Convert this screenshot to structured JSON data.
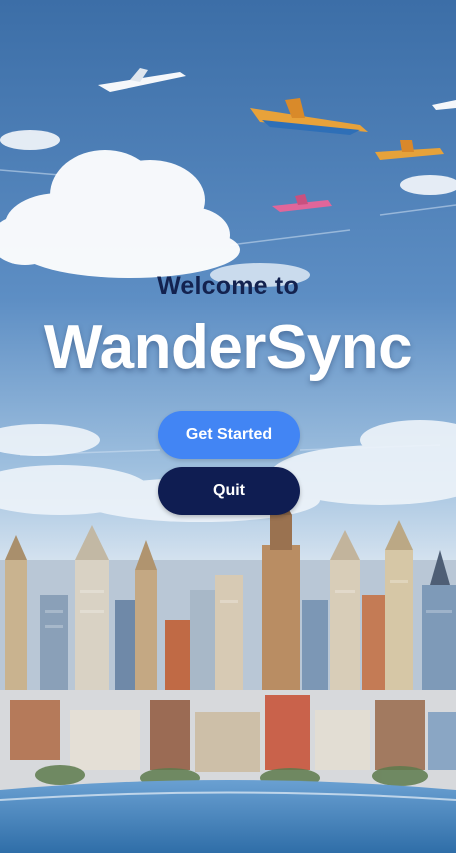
{
  "welcome": {
    "line1": "Welcome to",
    "app_name": "WanderSync"
  },
  "buttons": {
    "get_started_label": "Get Started",
    "quit_label": "Quit"
  },
  "colors": {
    "primary_button": "#4285f4",
    "secondary_button": "#0f1d52",
    "welcome_text": "#13224f",
    "brand_text": "#ffffff"
  },
  "background": {
    "icon": "sky-city-illustration"
  }
}
